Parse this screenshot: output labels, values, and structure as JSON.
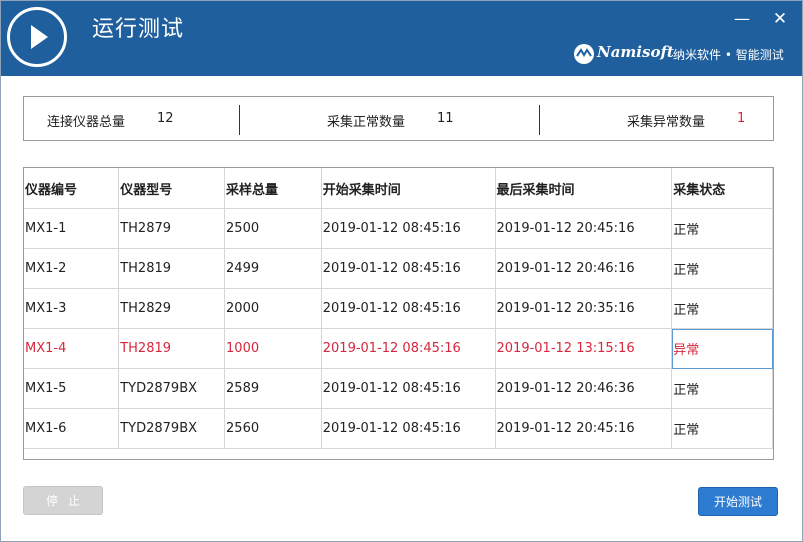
{
  "app": {
    "title": "运行测试",
    "brand_name": "Namisoft",
    "brand_subtitle": "纳米软件 • 智能测试",
    "colors": {
      "titlebar": "#1f5f9e",
      "abnormal": "#d7263d",
      "primary_button": "#2e7cd1"
    }
  },
  "window_controls": {
    "minimize": "—",
    "close": "✕"
  },
  "stats": {
    "total_label": "连接仪器总量",
    "total_value": "12",
    "normal_label": "采集正常数量",
    "normal_value": "11",
    "abnormal_label": "采集异常数量",
    "abnormal_value": "1"
  },
  "table": {
    "columns": [
      "仪器编号",
      "仪器型号",
      "采样总量",
      "开始采集时间",
      "最后采集时间",
      "采集状态"
    ],
    "rows": [
      [
        "MX1-1",
        "TH2879",
        "2500",
        "2019-01-12 08:45:16",
        "2019-01-12 20:45:16",
        "正常"
      ],
      [
        "MX1-2",
        "TH2819",
        "2499",
        "2019-01-12 08:45:16",
        "2019-01-12 20:46:16",
        "正常"
      ],
      [
        "MX1-3",
        "TH2829",
        "2000",
        "2019-01-12 08:45:16",
        "2019-01-12 20:35:16",
        "正常"
      ],
      [
        "MX1-4",
        "TH2819",
        "1000",
        "2019-01-12 08:45:16",
        "2019-01-12 13:15:16",
        "异常"
      ],
      [
        "MX1-5",
        "TYD2879BX",
        "2589",
        "2019-01-12 08:45:16",
        "2019-01-12 20:46:36",
        "正常"
      ],
      [
        "MX1-6",
        "TYD2879BX",
        "2560",
        "2019-01-12 08:45:16",
        "2019-01-12 20:45:16",
        "正常"
      ]
    ]
  },
  "buttons": {
    "stop": "停止",
    "start": "开始测试"
  }
}
